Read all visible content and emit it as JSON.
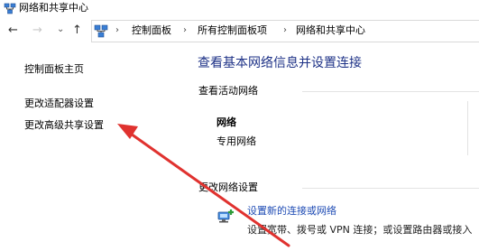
{
  "window": {
    "title": "网络和共享中心"
  },
  "address_bar": {
    "breadcrumbs": [
      "控制面板",
      "所有控制面板项",
      "网络和共享中心"
    ]
  },
  "sidebar": {
    "items": [
      {
        "label": "控制面板主页"
      },
      {
        "label": "更改适配器设置"
      },
      {
        "label": "更改高级共享设置"
      }
    ]
  },
  "main": {
    "title": "查看基本网络信息并设置连接",
    "active_networks_label": "查看活动网络",
    "network": {
      "name": "网络",
      "type": "专用网络"
    },
    "change_settings_label": "更改网络设置",
    "setup_connection": {
      "link": "设置新的连接或网络",
      "description": "设置宽带、拨号或 VPN 连接；或设置路由器或接入"
    }
  },
  "annotation": {
    "arrow_color": "#e0322f"
  }
}
